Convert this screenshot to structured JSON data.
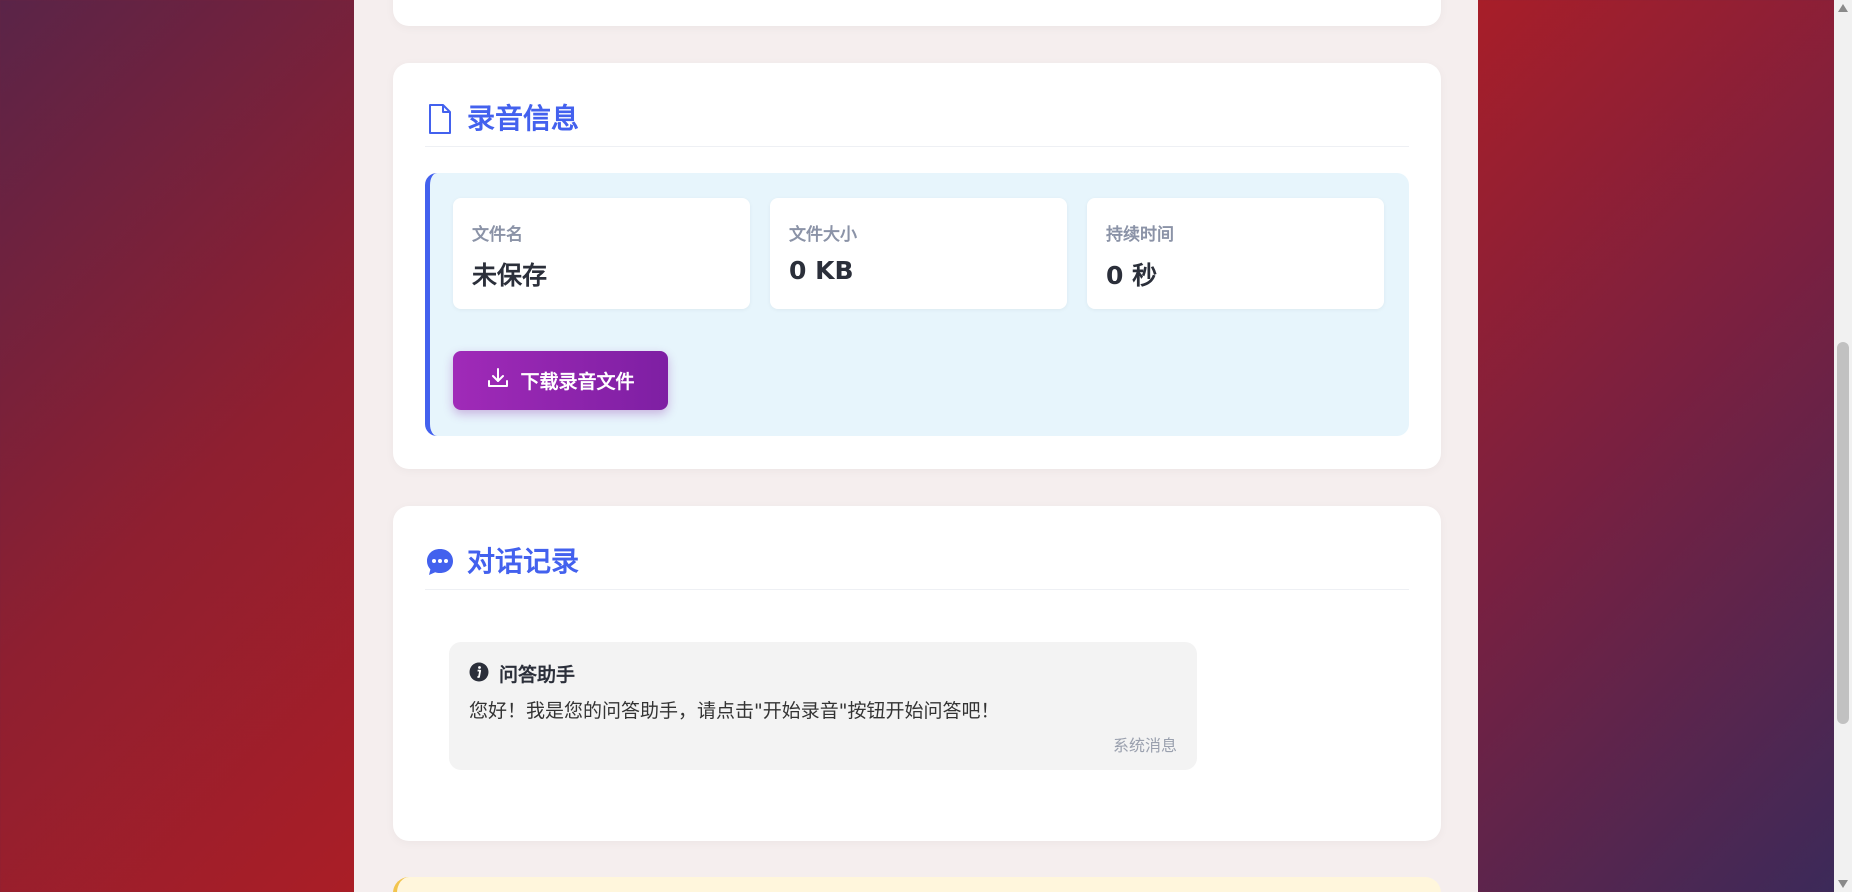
{
  "recording_info": {
    "title": "录音信息",
    "icon": "file-icon",
    "stats": [
      {
        "label": "文件名",
        "value": "未保存"
      },
      {
        "label": "文件大小",
        "value": "0 KB"
      },
      {
        "label": "持续时间",
        "value": "0 秒"
      }
    ],
    "download_label": "下载录音文件"
  },
  "chat": {
    "title": "对话记录",
    "icon": "chat-bubble-icon",
    "messages": [
      {
        "sender": "问答助手",
        "text": "您好！我是您的问答助手，请点击\"开始录音\"按钮开始问答吧！",
        "meta": "系统消息"
      }
    ]
  },
  "colors": {
    "accent": "#4361ee",
    "download_button": "#9b27b5",
    "info_panel_bg": "#e7f5fc"
  }
}
